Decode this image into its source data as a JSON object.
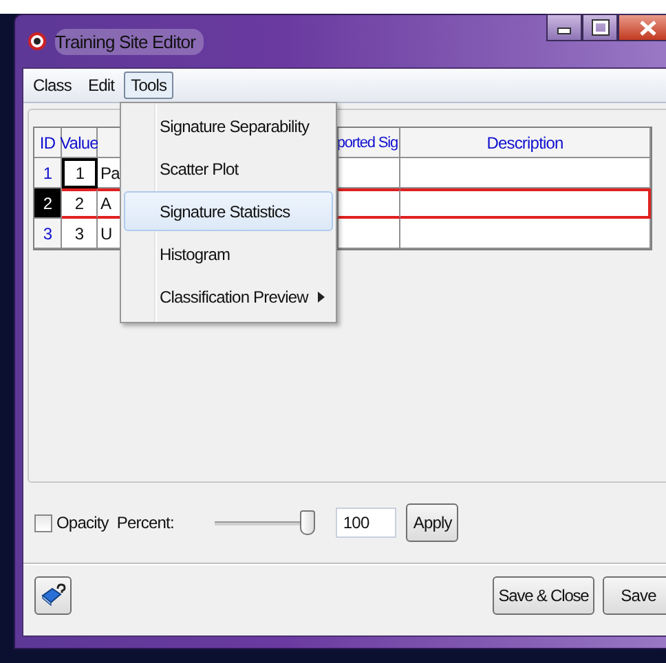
{
  "window": {
    "title": "Training Site Editor"
  },
  "menu_bar": [
    {
      "label": "Class",
      "selected": false
    },
    {
      "label": "Edit",
      "selected": false
    },
    {
      "label": "Tools",
      "selected": true
    }
  ],
  "tools_menu": [
    {
      "label": "Signature Separability",
      "selected": false,
      "has_submenu": false
    },
    {
      "label": "Scatter Plot",
      "selected": false,
      "has_submenu": false
    },
    {
      "label": "Signature Statistics",
      "selected": true,
      "has_submenu": false
    },
    {
      "label": "Histogram",
      "selected": false,
      "has_submenu": false
    },
    {
      "label": "Classification Preview",
      "selected": false,
      "has_submenu": true
    }
  ],
  "table": {
    "columns": [
      "ID",
      "Value",
      "ported Sig",
      "Description"
    ],
    "rows": [
      {
        "id": "1",
        "value": "1",
        "name": "Pa",
        "selected": false,
        "focused": true
      },
      {
        "id": "2",
        "value": "2",
        "name": "A",
        "selected": true,
        "focused": false
      },
      {
        "id": "3",
        "value": "3",
        "name": "U",
        "selected": false,
        "focused": false
      }
    ]
  },
  "opacity": {
    "checked": false,
    "label": "Opacity",
    "percent_label": "Percent:",
    "level": 1,
    "value": "100",
    "apply": "Apply"
  },
  "buttons": [
    "Save & Close",
    "Save"
  ]
}
